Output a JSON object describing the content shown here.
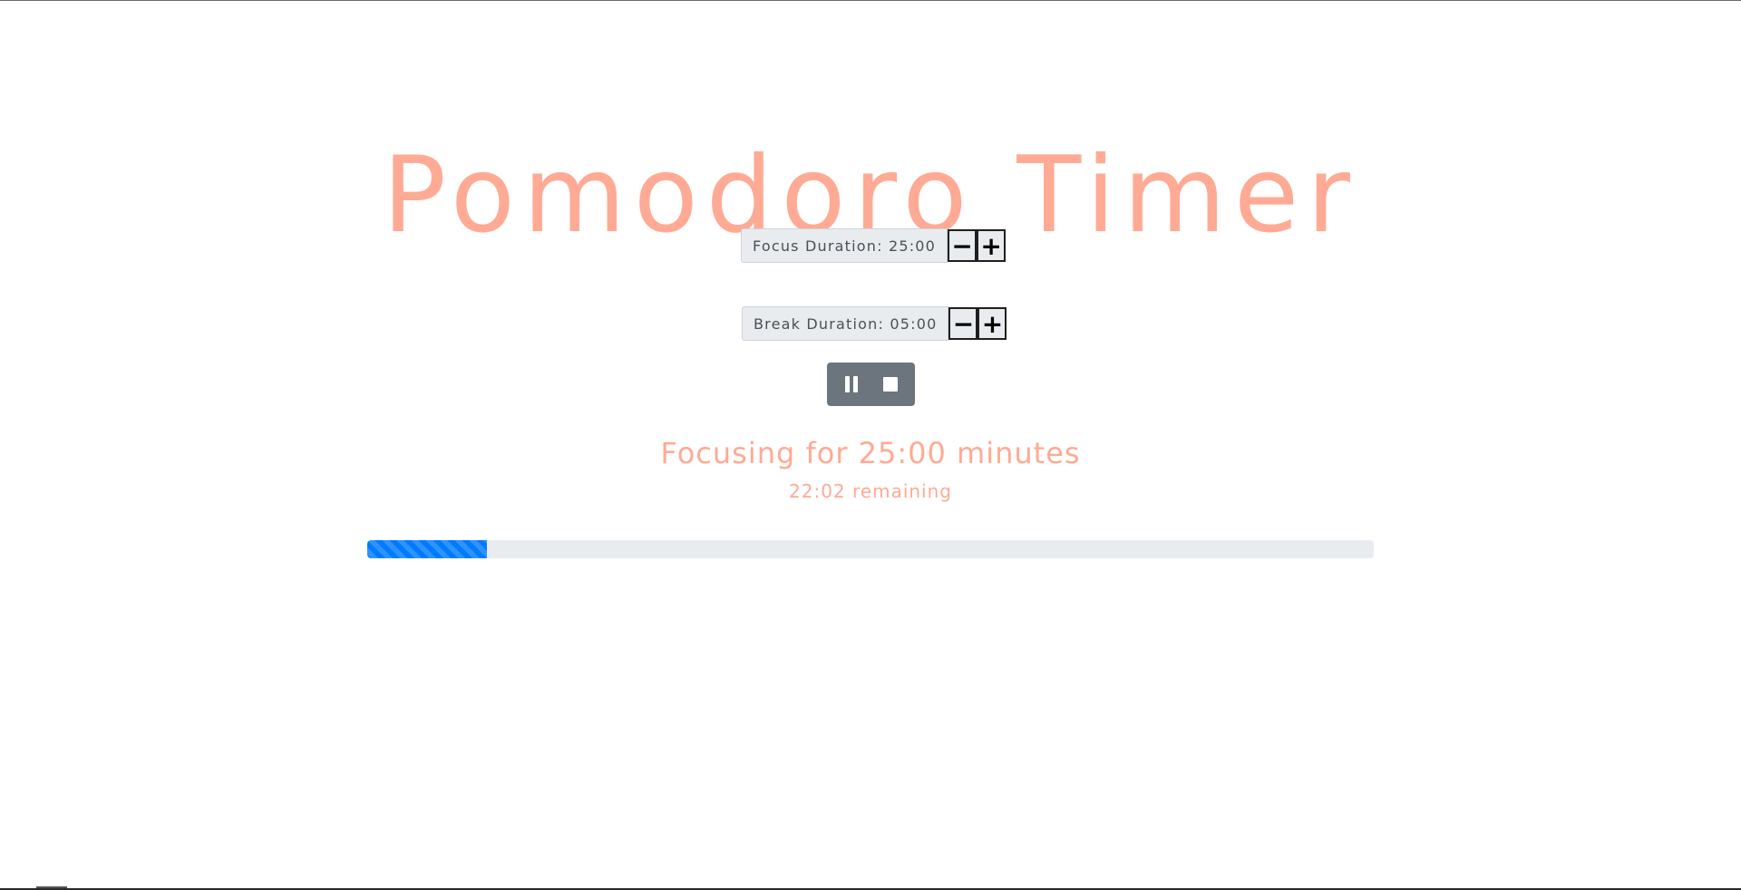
{
  "app": {
    "title": "Pomodoro Timer",
    "accent_color": "#ffaa94"
  },
  "focus": {
    "label": "Focus Duration: 25:00",
    "decrement_label": "−",
    "increment_label": "+"
  },
  "break": {
    "label": "Break Duration: 05:00",
    "decrement_label": "−",
    "increment_label": "+"
  },
  "controls": {
    "pause_icon": "pause-icon",
    "stop_icon": "stop-icon",
    "background_color": "#6c757d"
  },
  "status": {
    "message": "Focusing for 25:00 minutes",
    "remaining": "22:02 remaining"
  },
  "progress": {
    "value_fraction": 0.119,
    "color": "#007bff",
    "striped": true
  }
}
